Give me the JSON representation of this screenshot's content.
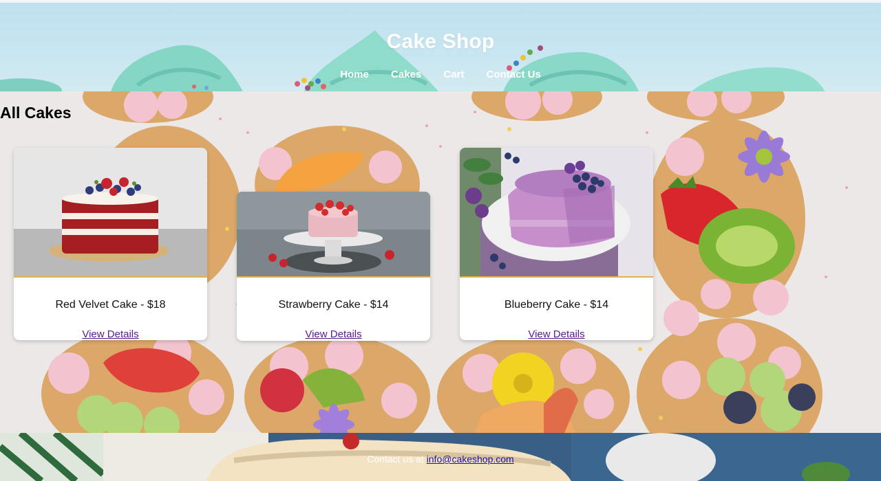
{
  "header": {
    "title": "Cake Shop",
    "nav": [
      "Home",
      "Cakes",
      "Cart",
      "Contact Us"
    ]
  },
  "main": {
    "section_title": "All Cakes",
    "cards": [
      {
        "name": "Red Velvet Cake - $18",
        "link": "View Details",
        "image": "red-velvet-cake-image"
      },
      {
        "name": "Strawberry Cake - $14",
        "link": "View Details",
        "image": "strawberry-cake-image"
      },
      {
        "name": "Blueberry Cake - $14",
        "link": "View Details",
        "image": "blueberry-cake-image"
      }
    ]
  },
  "footer": {
    "text": "Contact us at",
    "email": "info@cakeshop.com"
  },
  "colors": {
    "link": "#551a8b",
    "footer_link": "#1a0dab",
    "card_accent": "#e2b24a",
    "header_bg": "#c7e6f1"
  }
}
